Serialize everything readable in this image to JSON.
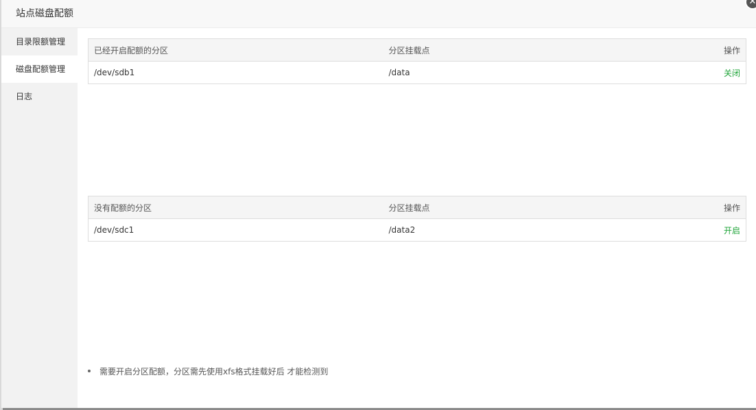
{
  "dialog": {
    "title": "站点磁盘配额",
    "close_icon": "✕"
  },
  "sidebar": {
    "items": [
      {
        "label": "目录限额管理"
      },
      {
        "label": "磁盘配额管理"
      },
      {
        "label": "日志"
      }
    ],
    "active_index": 1
  },
  "enabled_table": {
    "headers": [
      "已经开启配额的分区",
      "分区挂载点",
      "操作"
    ],
    "rows": [
      {
        "partition": "/dev/sdb1",
        "mount": "/data",
        "action": "关闭"
      }
    ]
  },
  "disabled_table": {
    "headers": [
      "没有配额的分区",
      "分区挂载点",
      "操作"
    ],
    "rows": [
      {
        "partition": "/dev/sdc1",
        "mount": "/data2",
        "action": "开启"
      }
    ]
  },
  "tips": [
    "需要开启分区配额，分区需先使用xfs格式挂载好后 才能检测到"
  ],
  "colors": {
    "accent": "#20a53a",
    "sidebar_bg": "#f2f2f2",
    "header_bg": "#f8f8f8"
  }
}
